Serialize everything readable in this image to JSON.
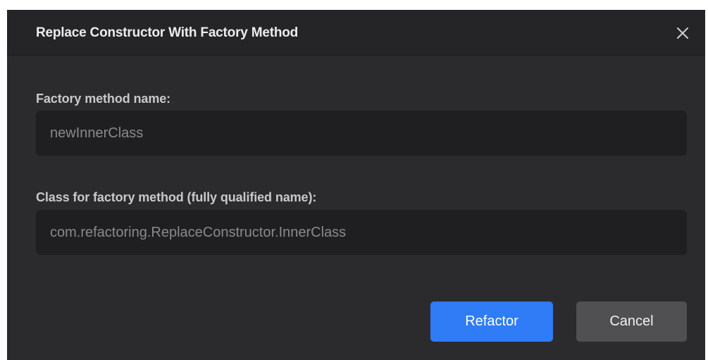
{
  "dialog": {
    "title": "Replace Constructor With Factory Method",
    "close_icon": "close-icon"
  },
  "form": {
    "factory_method_label": "Factory method name:",
    "factory_method_value": "newInnerClass",
    "class_label": "Class for factory method (fully qualified name):",
    "class_value": "com.refactoring.ReplaceConstructor.InnerClass"
  },
  "buttons": {
    "refactor_label": "Refactor",
    "cancel_label": "Cancel"
  },
  "colors": {
    "dialog_bg": "#2b2b2d",
    "titlebar_bg": "#252527",
    "field_bg": "#1f1f21",
    "primary_button": "#2f7cf6",
    "secondary_button": "#505052"
  }
}
